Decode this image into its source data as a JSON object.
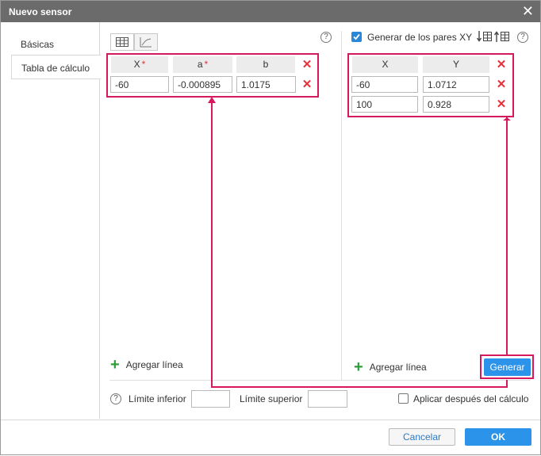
{
  "window": {
    "title": "Nuevo sensor",
    "close_icon": "close-icon"
  },
  "sidebar": {
    "items": [
      {
        "label": "Básicas"
      },
      {
        "label": "Tabla de cálculo"
      }
    ]
  },
  "left_table": {
    "headers": {
      "x": "X",
      "a": "a",
      "b": "b",
      "required_mark": "*"
    },
    "rows": [
      {
        "x": "-60",
        "a": "-0.000895",
        "b": "1.0175"
      }
    ],
    "add_line": "Agregar línea"
  },
  "right_table": {
    "generate_label": "Generar de los pares XY",
    "generate_checked": true,
    "headers": {
      "x": "X",
      "y": "Y"
    },
    "rows": [
      {
        "x": "-60",
        "y": "1.0712"
      },
      {
        "x": "100",
        "y": "0.928"
      }
    ],
    "add_line": "Agregar línea",
    "generate_button": "Generar"
  },
  "help_symbol": "?",
  "delete_symbol": "✕",
  "limits": {
    "lower_label": "Límite inferior",
    "upper_label": "Límite superior",
    "after_calc_label": "Aplicar después del cálculo",
    "after_calc_checked": false
  },
  "footer": {
    "cancel": "Cancelar",
    "ok": "OK"
  },
  "colors": {
    "accent": "#2b93ea",
    "highlight": "#d6195f",
    "delete": "#e8303a",
    "add": "#2f9d3a",
    "titlebar": "#6b6b6b"
  }
}
